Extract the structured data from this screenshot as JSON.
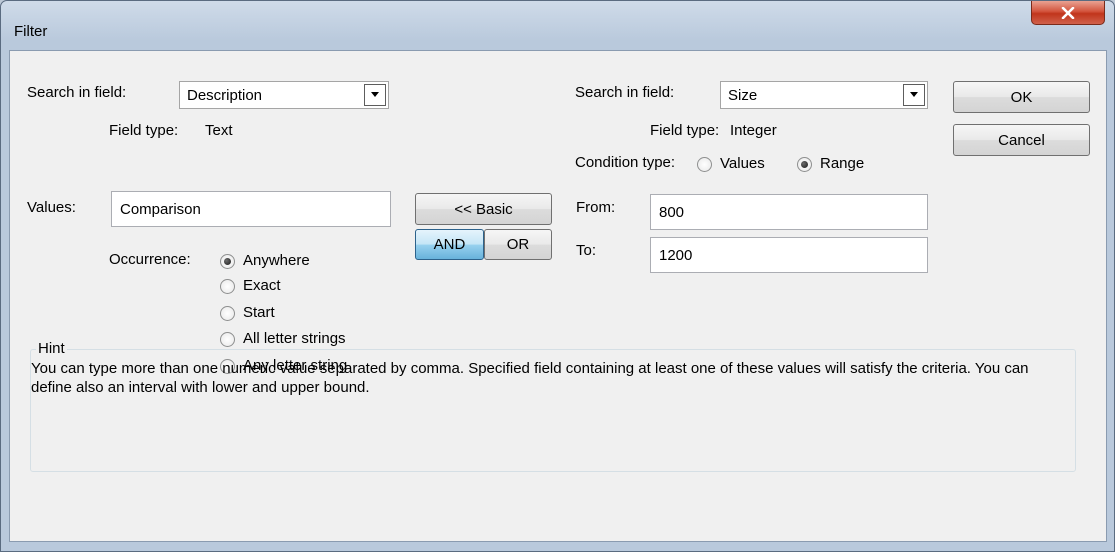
{
  "window": {
    "title": "Filter"
  },
  "left": {
    "search_label": "Search in field:",
    "search_value": "Description",
    "field_type_label": "Field type:",
    "field_type_value": "Text",
    "values_label": "Values:",
    "values_value": "Comparison",
    "occurrence_label": "Occurrence:",
    "occurrence_options": [
      {
        "label": "Anywhere",
        "selected": true
      },
      {
        "label": "Exact",
        "selected": false
      },
      {
        "label": "Start",
        "selected": false
      },
      {
        "label": "All letter strings",
        "selected": false
      },
      {
        "label": "Any letter string",
        "selected": false
      }
    ]
  },
  "middle": {
    "basic_button": "<< Basic",
    "and_button": "AND",
    "or_button": "OR"
  },
  "right": {
    "search_label": "Search in field:",
    "search_value": "Size",
    "field_type_label": "Field type:",
    "field_type_value": "Integer",
    "condition_label": "Condition type:",
    "condition_options": [
      {
        "label": "Values",
        "selected": false
      },
      {
        "label": "Range",
        "selected": true
      }
    ],
    "from_label": "From:",
    "from_value": "800",
    "to_label": "To:",
    "to_value": "1200"
  },
  "actions": {
    "ok": "OK",
    "cancel": "Cancel"
  },
  "hint": {
    "title": "Hint",
    "text": "You can type more than one numeric value separated by comma. Specified field containing at least one of these values will satisfy the criteria. You can define also an interval with lower and upper bound."
  }
}
